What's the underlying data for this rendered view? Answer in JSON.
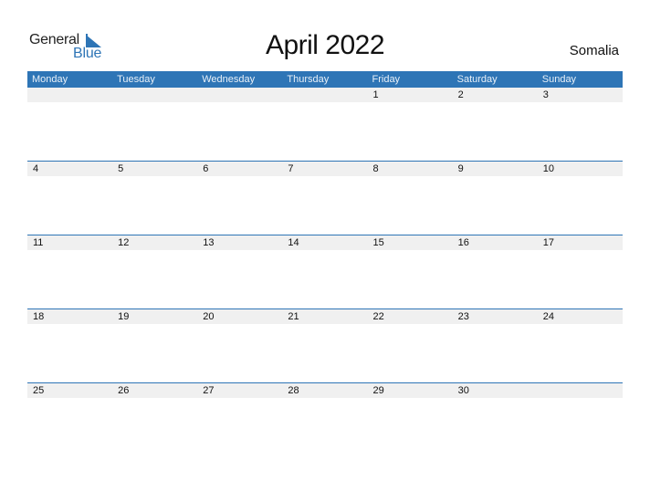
{
  "logo": {
    "line1": "General",
    "line2": "Blue"
  },
  "title": "April 2022",
  "country": "Somalia",
  "colors": {
    "accent": "#2e75b6",
    "strip": "#f0f0f0"
  },
  "weekdays": [
    "Monday",
    "Tuesday",
    "Wednesday",
    "Thursday",
    "Friday",
    "Saturday",
    "Sunday"
  ],
  "weeks": [
    [
      "",
      "",
      "",
      "",
      "1",
      "2",
      "3"
    ],
    [
      "4",
      "5",
      "6",
      "7",
      "8",
      "9",
      "10"
    ],
    [
      "11",
      "12",
      "13",
      "14",
      "15",
      "16",
      "17"
    ],
    [
      "18",
      "19",
      "20",
      "21",
      "22",
      "23",
      "24"
    ],
    [
      "25",
      "26",
      "27",
      "28",
      "29",
      "30",
      ""
    ]
  ]
}
